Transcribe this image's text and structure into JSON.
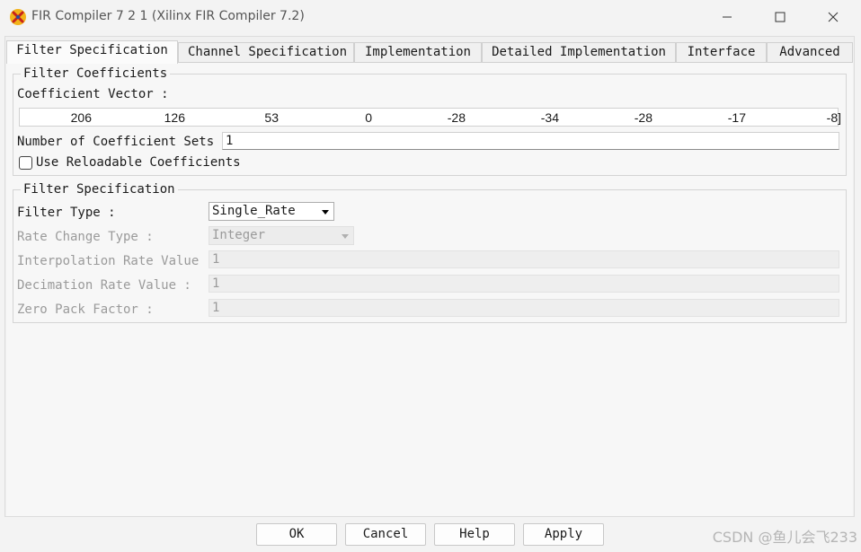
{
  "window": {
    "title": "FIR Compiler 7 2 1 (Xilinx FIR Compiler 7.2)",
    "icon": "xilinx-logo-icon",
    "controls": [
      "minimize-icon",
      "maximize-icon",
      "close-icon"
    ]
  },
  "tabs": [
    {
      "label": "Filter Specification",
      "active": true
    },
    {
      "label": "Channel Specification",
      "active": false
    },
    {
      "label": "Implementation",
      "active": false
    },
    {
      "label": "Detailed Implementation",
      "active": false
    },
    {
      "label": "Interface",
      "active": false
    },
    {
      "label": "Advanced",
      "active": false
    }
  ],
  "coefficients_group": {
    "legend": "Filter Coefficients",
    "vector_label": "Coefficient Vector :",
    "vector_values": [
      "206",
      "126",
      "53",
      "0",
      "-28",
      "-34",
      "-28",
      "-17",
      "-8]"
    ],
    "sets_label": "Number of Coefficient Sets :",
    "sets_value": "1",
    "reload_label": "Use Reloadable Coefficients",
    "reload_checked": false
  },
  "spec_group": {
    "legend": "Filter Specification",
    "filter_type_label": "Filter Type :",
    "filter_type_value": "Single_Rate",
    "rate_change_label": "Rate Change Type :",
    "rate_change_value": "Integer",
    "interp_label": "Interpolation Rate Value :",
    "interp_value": "1",
    "decim_label": "Decimation Rate Value :",
    "decim_value": "1",
    "zero_pack_label": "Zero Pack Factor :",
    "zero_pack_value": "1"
  },
  "buttons": {
    "ok": "OK",
    "cancel": "Cancel",
    "help": "Help",
    "apply": "Apply"
  },
  "watermark": "CSDN @鱼儿会飞233",
  "colors": {
    "background": "#f3f3f3",
    "disabled_text": "#9a9a9a"
  }
}
